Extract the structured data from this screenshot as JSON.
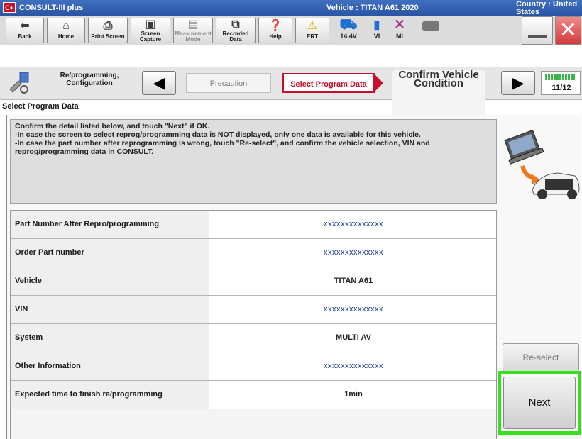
{
  "window": {
    "logo_text": "C+",
    "app_title": "CONSULT-III plus",
    "vehicle_label": "Vehicle : TITAN A61 2020",
    "country_label": "Country : United States"
  },
  "toolbar": {
    "back": {
      "label": "Back",
      "icon": "back-arrow-icon"
    },
    "home": {
      "label": "Home",
      "icon": "home-icon"
    },
    "print_screen": {
      "label": "Print Screen",
      "icon": "printer-icon"
    },
    "screen_capture": {
      "label": "Screen Capture",
      "icon": "camera-icon"
    },
    "measurement_mode": {
      "label": "Measurement Mode",
      "icon": "measurement-icon"
    },
    "recorded_data": {
      "label": "Recorded Data",
      "icon": "recorded-data-icon"
    },
    "help": {
      "label": "Help",
      "icon": "help-icon"
    },
    "ert": {
      "label": "ERT",
      "icon": "warning-icon"
    },
    "battery_voltage": "14.4V",
    "vi_label": "VI",
    "mi_label": "MI"
  },
  "breadcrumb": {
    "mode_label": "Re/programming, Configuration",
    "steps": [
      {
        "label": "Precaution",
        "state": "inactive"
      },
      {
        "label": "Select Program Data",
        "state": "active"
      },
      {
        "label": "Confirm Vehicle Condition",
        "state": "next"
      }
    ],
    "step_counter": "11/12",
    "progress_fraction": 0.917
  },
  "page_title": "Select Program Data",
  "instructions": "Confirm the detail listed below, and touch \"Next\" if OK.\n-In case the screen to select reprog/programming data is NOT displayed, only one data is available for this vehicle.\n-In case the part number after reprogramming is wrong, touch \"Re-select\", and confirm the vehicle selection, VIN and reprog/programming data in CONSULT.",
  "details": [
    {
      "label": "Part Number After Repro/programming",
      "value": "xxxxxxxxxxxxxx"
    },
    {
      "label": "Order Part number",
      "value": "xxxxxxxxxxxxxx"
    },
    {
      "label": "Vehicle",
      "value": "TITAN A61"
    },
    {
      "label": "VIN",
      "value": "xxxxxxxxxxxxxx"
    },
    {
      "label": "System",
      "value": "MULTI AV"
    },
    {
      "label": "Other Information",
      "value": "xxxxxxxxxxxxxx"
    },
    {
      "label": "Expected time to finish re/programming",
      "value": "1min"
    }
  ],
  "buttons": {
    "reselect": "Re-select",
    "next": "Next"
  },
  "colors": {
    "title_bar": "#2a55a4",
    "active_step": "#c8102e",
    "highlight": "#36e01f",
    "progress": "#39b54a"
  }
}
